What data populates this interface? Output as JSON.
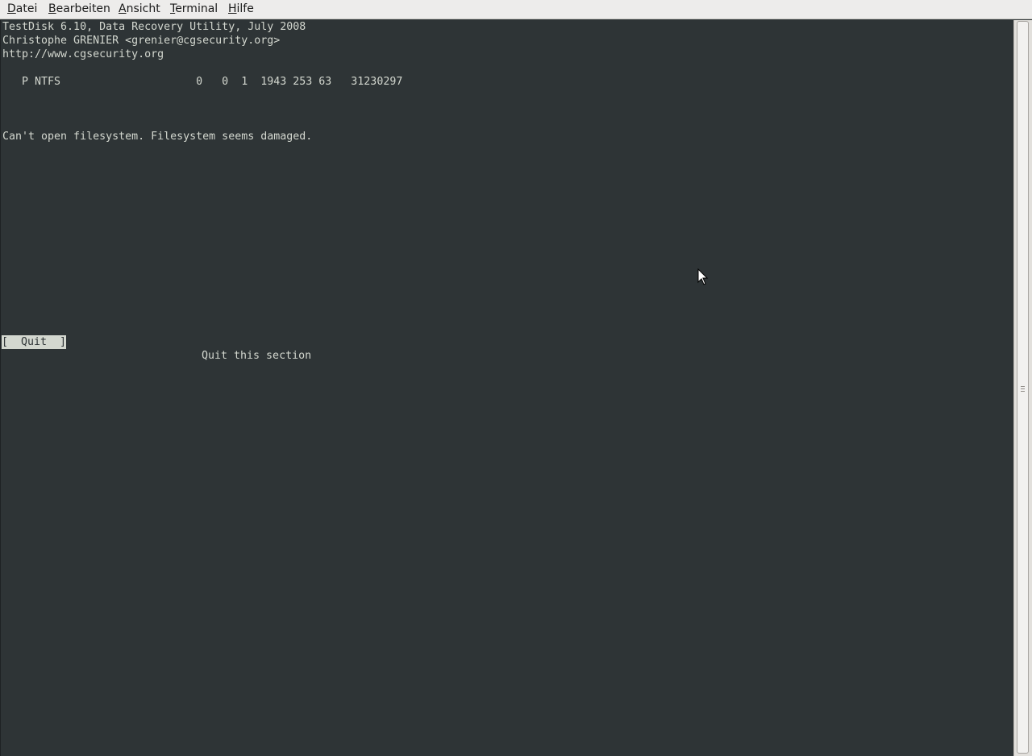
{
  "menubar": {
    "items": [
      {
        "first": "D",
        "rest": "atei"
      },
      {
        "first": "B",
        "rest": "earbeiten"
      },
      {
        "first": "A",
        "rest": "nsicht"
      },
      {
        "first": "T",
        "rest": "erminal"
      },
      {
        "first": "H",
        "rest": "ilfe"
      }
    ]
  },
  "terminal": {
    "lines": [
      "TestDisk 6.10, Data Recovery Utility, July 2008",
      "Christophe GRENIER <grenier@cgsecurity.org>",
      "http://www.cgsecurity.org",
      "   P NTFS                     0   0  1  1943 253 63   31230297",
      "Can't open filesystem. Filesystem seems damaged."
    ],
    "quit_button": "[  Quit  ]",
    "quit_hint": "Quit this section"
  },
  "colors": {
    "terminal_bg": "#2e3436",
    "terminal_fg": "#d3d7cf",
    "menubar_bg": "#edeceb"
  },
  "icons": {
    "mouse_cursor": "mouse-pointer-icon",
    "scrollbar_grip": "grip-icon"
  }
}
